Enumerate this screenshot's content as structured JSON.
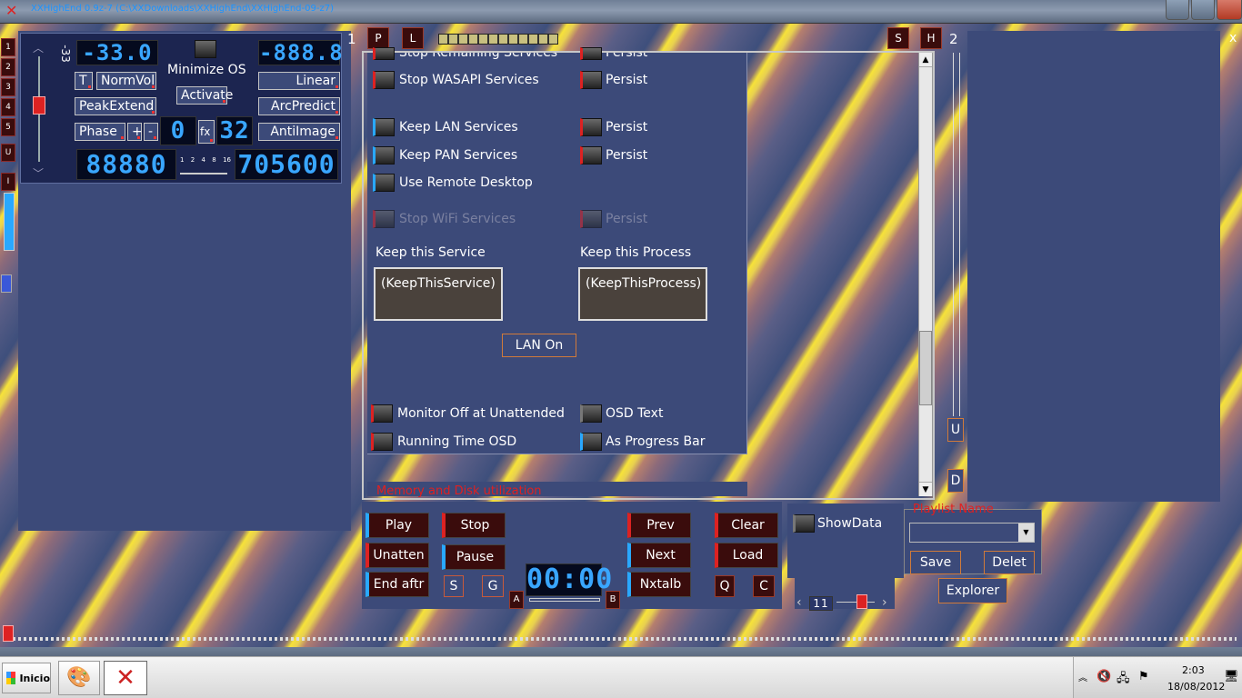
{
  "window": {
    "title": "XXHighEnd 0.9z-7 (C:\\XXDownloads\\XXHighEnd\\XXHighEnd-09-z7)"
  },
  "left_tabs": [
    "1",
    "2",
    "3",
    "4",
    "5",
    "U",
    "I"
  ],
  "volume": {
    "db_label": "-33",
    "display": "-33.0",
    "right_display": "-888.8",
    "small_display": "0",
    "fx_display": "32",
    "counter": "88880",
    "rate": "705600",
    "scale": [
      "1",
      "2",
      "4",
      "8",
      "16"
    ]
  },
  "options": {
    "minimize_os": "Minimize OS",
    "activate": "Activate",
    "t": "T",
    "normvol": "NormVol",
    "linear": "Linear",
    "peakextend": "PeakExtend",
    "arcpredict": "ArcPredict",
    "phase": "Phase",
    "plus": "+",
    "minus": "-",
    "fx": "fx",
    "antiimage": "AntiImage"
  },
  "topbar": {
    "one": "1",
    "p": "P",
    "l": "L",
    "s": "S",
    "h": "H",
    "two": "2",
    "x": "x"
  },
  "services": {
    "stop_remaining": "Stop Remaining Services",
    "persist1": "Persist",
    "stop_wasapi": "Stop WASAPI Services",
    "persist2": "Persist",
    "keep_lan": "Keep LAN Services",
    "persist3": "Persist",
    "keep_pan": "Keep PAN Services",
    "persist4": "Persist",
    "remote_desktop": "Use Remote Desktop",
    "stop_wifi": "Stop WiFi Services",
    "persist5": "Persist",
    "keep_service_label": "Keep this Service",
    "keep_service_value": "(KeepThisService)",
    "keep_process_label": "Keep this Process",
    "keep_process_value": "(KeepThisProcess)",
    "lan_on": "LAN On",
    "monitor_off": "Monitor Off at Unattended",
    "osd_text": "OSD Text",
    "running_time": "Running Time OSD",
    "progress_bar": "As Progress Bar",
    "memory_label": "Memory and Disk utilization"
  },
  "side_ud": {
    "u": "U",
    "d": "D"
  },
  "transport": {
    "play": "Play",
    "stop": "Stop",
    "prev": "Prev",
    "clear": "Clear",
    "unatten": "Unatten",
    "pause": "Pause",
    "next": "Next",
    "load": "Load",
    "end_aftr": "End aftr",
    "s": "S",
    "g": "G",
    "nxtalb": "Nxtalb",
    "q": "Q",
    "c": "C",
    "time": "00:00",
    "a": "A",
    "b": "B"
  },
  "playlist": {
    "showdata": "ShowData",
    "name_label": "Playlist Name",
    "save": "Save",
    "delet": "Delet",
    "explorer": "Explorer",
    "number": "11"
  },
  "taskbar": {
    "start": "Inicio",
    "time": "2:03",
    "date": "18/08/2012"
  }
}
